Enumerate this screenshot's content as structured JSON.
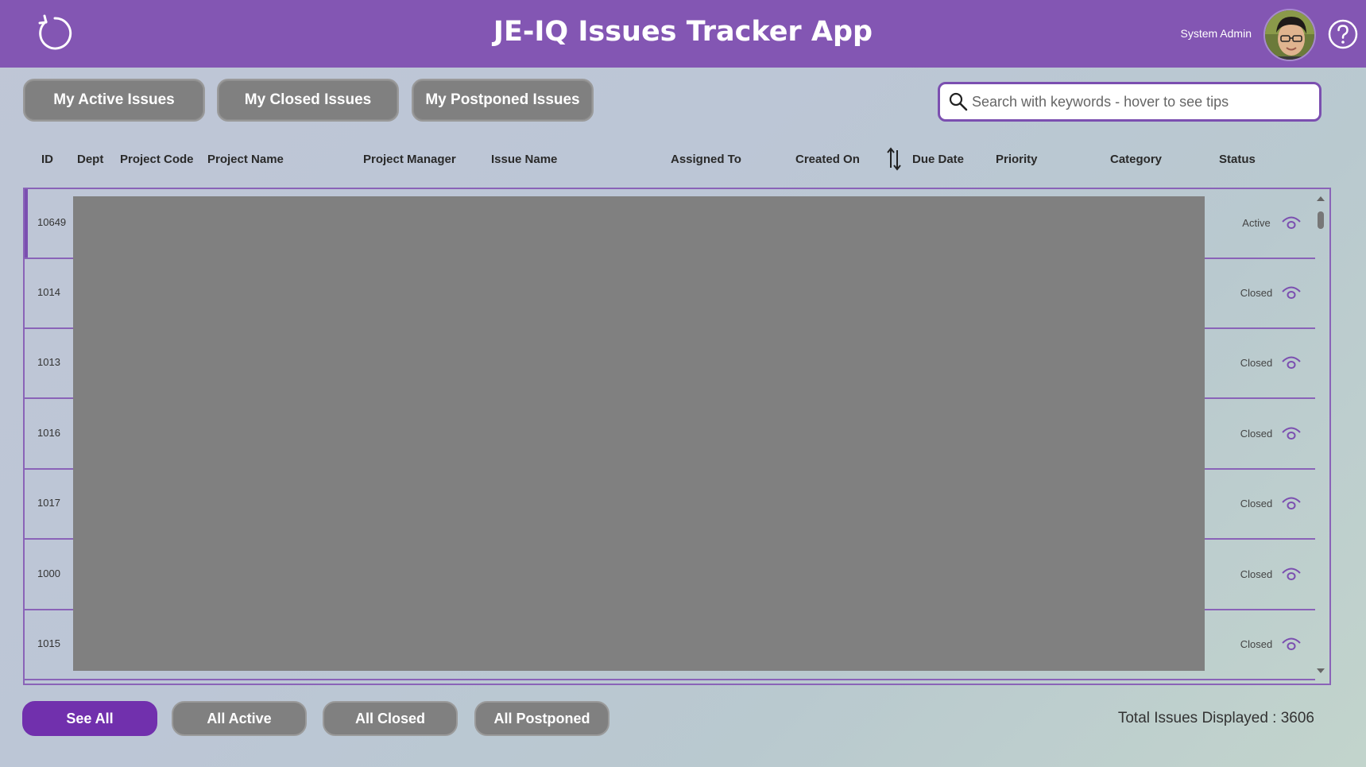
{
  "header": {
    "title": "JE-IQ Issues Tracker App",
    "user_name": "System Admin",
    "refresh_icon": "refresh-icon",
    "help_icon": "help-circle-icon",
    "color": "#8356b3"
  },
  "tabs": [
    {
      "label": "My Active Issues"
    },
    {
      "label": "My Closed Issues"
    },
    {
      "label": "My Postponed Issues"
    }
  ],
  "search": {
    "placeholder": "Search with keywords - hover to see tips",
    "icon": "search-icon"
  },
  "columns": [
    "ID",
    "Dept",
    "Project Code",
    "Project Name",
    "Project Manager",
    "Issue Name",
    "Assigned To",
    "Created On",
    "Due Date",
    "Priority",
    "Category",
    "Status"
  ],
  "rows": [
    {
      "id": "10649",
      "status": "Active"
    },
    {
      "id": "1014",
      "status": "Closed"
    },
    {
      "id": "1013",
      "status": "Closed"
    },
    {
      "id": "1016",
      "status": "Closed"
    },
    {
      "id": "1017",
      "status": "Closed"
    },
    {
      "id": "1000",
      "status": "Closed"
    },
    {
      "id": "1015",
      "status": "Closed"
    }
  ],
  "filters": [
    {
      "label": "See All"
    },
    {
      "label": "All Active"
    },
    {
      "label": "All Closed"
    },
    {
      "label": "All Postponed"
    }
  ],
  "footer": {
    "total_label": "Total Issues Displayed : 3606"
  },
  "colors": {
    "accent": "#7b4fb0",
    "button_gray": "#808080",
    "active_filter": "#7130ad"
  }
}
